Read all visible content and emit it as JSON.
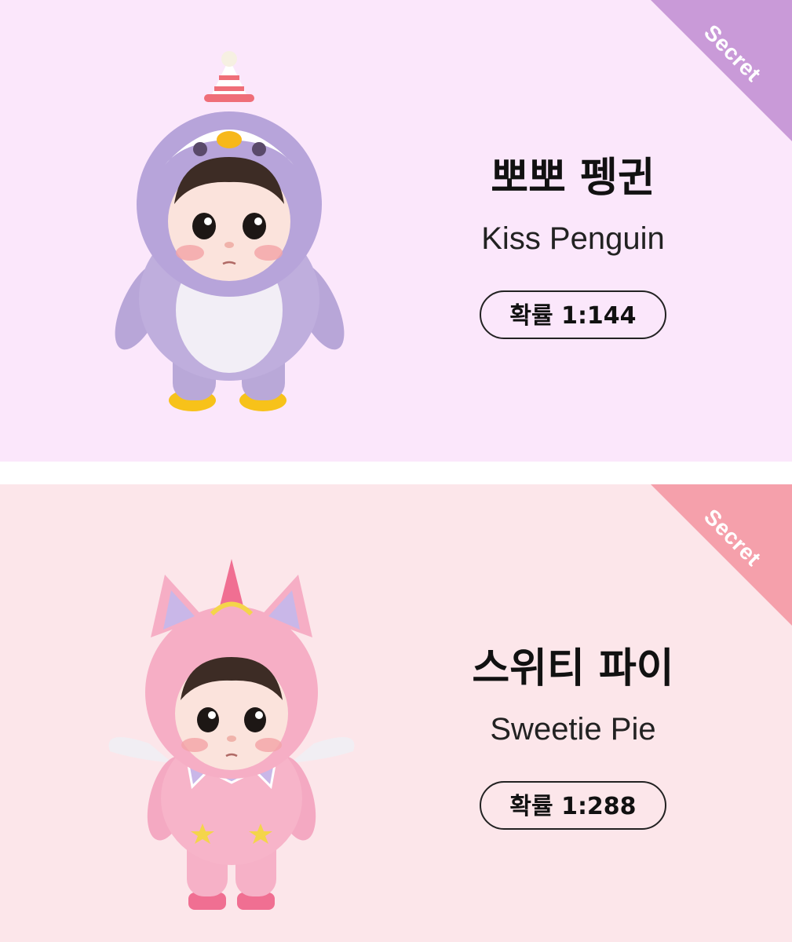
{
  "cards": [
    {
      "badge": "Secret",
      "name_ko": "뽀뽀 펭귄",
      "name_en": "Kiss Penguin",
      "odds": "확률 1:144",
      "colors": {
        "background": "#fbe7fb",
        "ribbon": "#c99ad8"
      }
    },
    {
      "badge": "Secret",
      "name_ko": "스위티 파이",
      "name_en": "Sweetie Pie",
      "odds": "확률 1:288",
      "colors": {
        "background": "#fce6ea",
        "ribbon": "#f5a0ab"
      }
    }
  ]
}
